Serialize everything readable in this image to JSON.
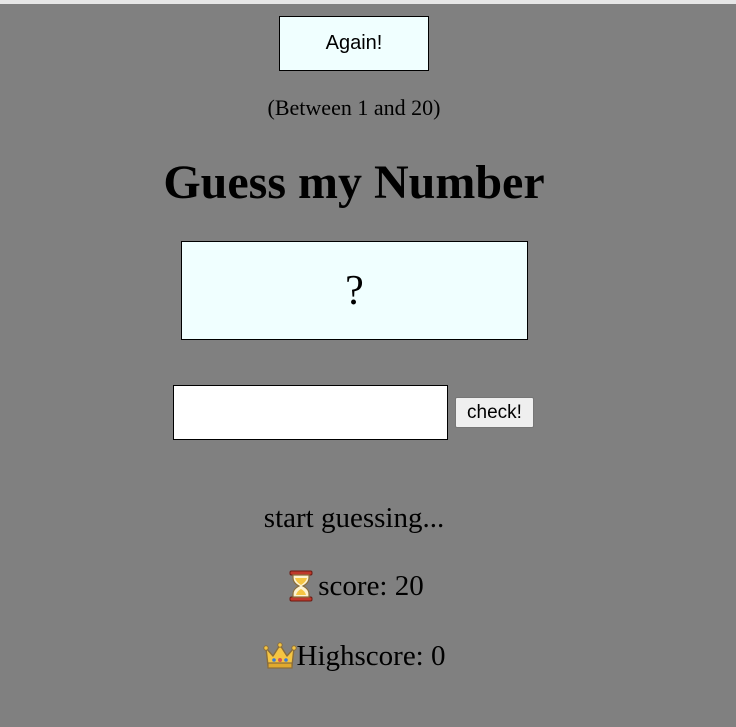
{
  "game": {
    "again_label": "Again!",
    "range_hint": "(Between 1 and 20)",
    "title": "Guess my Number",
    "secret_display": "?",
    "guess_value": "",
    "check_label": "check!",
    "message": "start guessing...",
    "score_label": "score: ",
    "score_value": "20",
    "score_icon": "hourglass-icon",
    "highscore_label": "Highscore: ",
    "highscore_value": "0",
    "highscore_icon": "crown-icon"
  },
  "colors": {
    "background": "#808080",
    "panel": "#f0ffff"
  }
}
